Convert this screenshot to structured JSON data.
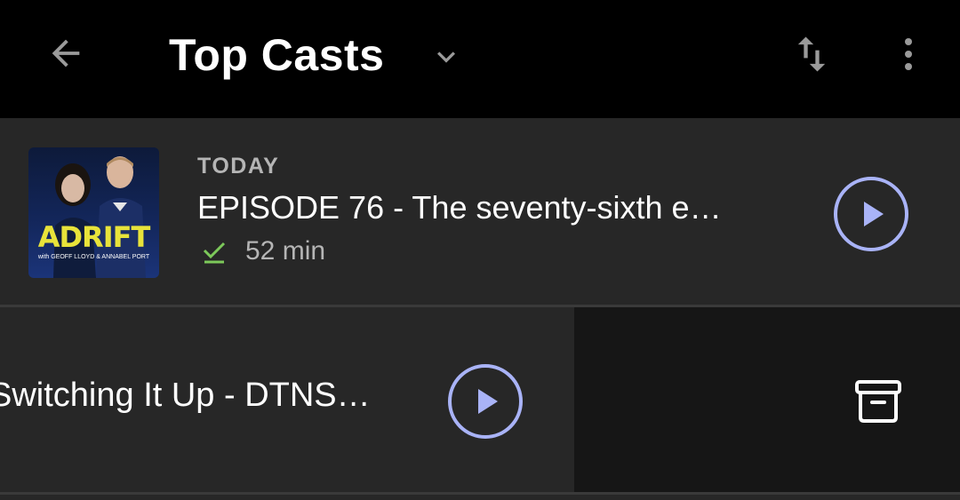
{
  "header": {
    "title": "Top Casts",
    "back_icon": "arrow-left-icon",
    "dropdown_icon": "chevron-down-icon",
    "sort_icon": "sort-arrows-icon",
    "more_icon": "more-vertical-icon"
  },
  "episodes": [
    {
      "artwork": {
        "icon": "podcast-artwork",
        "show_name": "ADRIFT",
        "subtitle": "with GEOFF LLOYD & ANNABEL PORT"
      },
      "date": "TODAY",
      "title": "EPISODE 76 - The seventy-sixth e…",
      "status_icon": "downloaded-check-icon",
      "duration": "52 min",
      "play_icon": "play-icon"
    },
    {
      "title": "Switching It Up - DTNS…",
      "play_icon": "play-icon",
      "swipe_action_icon": "archive-icon"
    }
  ],
  "colors": {
    "accent": "#a9b3f7",
    "downloaded": "#7cc85a",
    "header_bg": "#000000",
    "row_bg": "#272727",
    "swipe_bg": "#161616",
    "secondary_text": "#b5b5b5"
  }
}
